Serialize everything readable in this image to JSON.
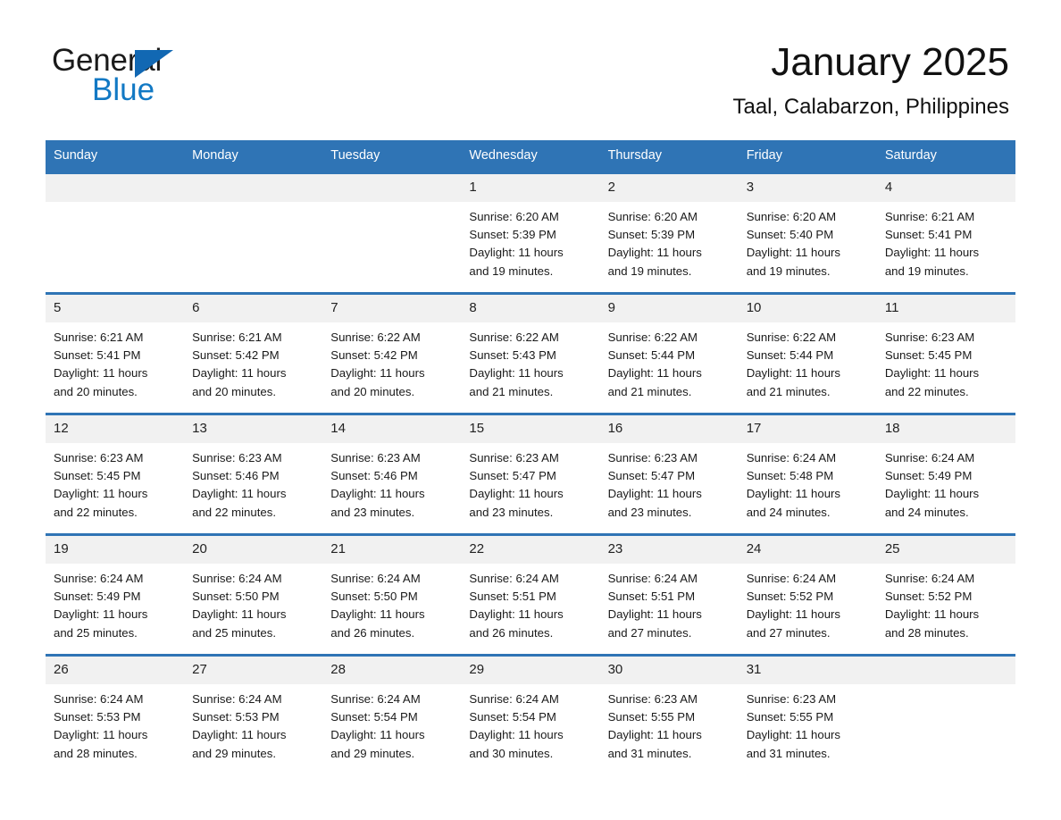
{
  "brand": {
    "name_part1": "General",
    "name_part2": "Blue",
    "accent_color": "#1279c4",
    "triangle_color": "#1268b3"
  },
  "header": {
    "month_title": "January 2025",
    "location": "Taal, Calabarzon, Philippines",
    "header_bg": "#2f74b5"
  },
  "weekdays": [
    "Sunday",
    "Monday",
    "Tuesday",
    "Wednesday",
    "Thursday",
    "Friday",
    "Saturday"
  ],
  "weeks": [
    [
      {
        "date": "",
        "empty": true
      },
      {
        "date": "",
        "empty": true
      },
      {
        "date": "",
        "empty": true
      },
      {
        "date": "1",
        "sunrise": "Sunrise: 6:20 AM",
        "sunset": "Sunset: 5:39 PM",
        "daylight_line1": "Daylight: 11 hours",
        "daylight_line2": "and 19 minutes."
      },
      {
        "date": "2",
        "sunrise": "Sunrise: 6:20 AM",
        "sunset": "Sunset: 5:39 PM",
        "daylight_line1": "Daylight: 11 hours",
        "daylight_line2": "and 19 minutes."
      },
      {
        "date": "3",
        "sunrise": "Sunrise: 6:20 AM",
        "sunset": "Sunset: 5:40 PM",
        "daylight_line1": "Daylight: 11 hours",
        "daylight_line2": "and 19 minutes."
      },
      {
        "date": "4",
        "sunrise": "Sunrise: 6:21 AM",
        "sunset": "Sunset: 5:41 PM",
        "daylight_line1": "Daylight: 11 hours",
        "daylight_line2": "and 19 minutes."
      }
    ],
    [
      {
        "date": "5",
        "sunrise": "Sunrise: 6:21 AM",
        "sunset": "Sunset: 5:41 PM",
        "daylight_line1": "Daylight: 11 hours",
        "daylight_line2": "and 20 minutes."
      },
      {
        "date": "6",
        "sunrise": "Sunrise: 6:21 AM",
        "sunset": "Sunset: 5:42 PM",
        "daylight_line1": "Daylight: 11 hours",
        "daylight_line2": "and 20 minutes."
      },
      {
        "date": "7",
        "sunrise": "Sunrise: 6:22 AM",
        "sunset": "Sunset: 5:42 PM",
        "daylight_line1": "Daylight: 11 hours",
        "daylight_line2": "and 20 minutes."
      },
      {
        "date": "8",
        "sunrise": "Sunrise: 6:22 AM",
        "sunset": "Sunset: 5:43 PM",
        "daylight_line1": "Daylight: 11 hours",
        "daylight_line2": "and 21 minutes."
      },
      {
        "date": "9",
        "sunrise": "Sunrise: 6:22 AM",
        "sunset": "Sunset: 5:44 PM",
        "daylight_line1": "Daylight: 11 hours",
        "daylight_line2": "and 21 minutes."
      },
      {
        "date": "10",
        "sunrise": "Sunrise: 6:22 AM",
        "sunset": "Sunset: 5:44 PM",
        "daylight_line1": "Daylight: 11 hours",
        "daylight_line2": "and 21 minutes."
      },
      {
        "date": "11",
        "sunrise": "Sunrise: 6:23 AM",
        "sunset": "Sunset: 5:45 PM",
        "daylight_line1": "Daylight: 11 hours",
        "daylight_line2": "and 22 minutes."
      }
    ],
    [
      {
        "date": "12",
        "sunrise": "Sunrise: 6:23 AM",
        "sunset": "Sunset: 5:45 PM",
        "daylight_line1": "Daylight: 11 hours",
        "daylight_line2": "and 22 minutes."
      },
      {
        "date": "13",
        "sunrise": "Sunrise: 6:23 AM",
        "sunset": "Sunset: 5:46 PM",
        "daylight_line1": "Daylight: 11 hours",
        "daylight_line2": "and 22 minutes."
      },
      {
        "date": "14",
        "sunrise": "Sunrise: 6:23 AM",
        "sunset": "Sunset: 5:46 PM",
        "daylight_line1": "Daylight: 11 hours",
        "daylight_line2": "and 23 minutes."
      },
      {
        "date": "15",
        "sunrise": "Sunrise: 6:23 AM",
        "sunset": "Sunset: 5:47 PM",
        "daylight_line1": "Daylight: 11 hours",
        "daylight_line2": "and 23 minutes."
      },
      {
        "date": "16",
        "sunrise": "Sunrise: 6:23 AM",
        "sunset": "Sunset: 5:47 PM",
        "daylight_line1": "Daylight: 11 hours",
        "daylight_line2": "and 23 minutes."
      },
      {
        "date": "17",
        "sunrise": "Sunrise: 6:24 AM",
        "sunset": "Sunset: 5:48 PM",
        "daylight_line1": "Daylight: 11 hours",
        "daylight_line2": "and 24 minutes."
      },
      {
        "date": "18",
        "sunrise": "Sunrise: 6:24 AM",
        "sunset": "Sunset: 5:49 PM",
        "daylight_line1": "Daylight: 11 hours",
        "daylight_line2": "and 24 minutes."
      }
    ],
    [
      {
        "date": "19",
        "sunrise": "Sunrise: 6:24 AM",
        "sunset": "Sunset: 5:49 PM",
        "daylight_line1": "Daylight: 11 hours",
        "daylight_line2": "and 25 minutes."
      },
      {
        "date": "20",
        "sunrise": "Sunrise: 6:24 AM",
        "sunset": "Sunset: 5:50 PM",
        "daylight_line1": "Daylight: 11 hours",
        "daylight_line2": "and 25 minutes."
      },
      {
        "date": "21",
        "sunrise": "Sunrise: 6:24 AM",
        "sunset": "Sunset: 5:50 PM",
        "daylight_line1": "Daylight: 11 hours",
        "daylight_line2": "and 26 minutes."
      },
      {
        "date": "22",
        "sunrise": "Sunrise: 6:24 AM",
        "sunset": "Sunset: 5:51 PM",
        "daylight_line1": "Daylight: 11 hours",
        "daylight_line2": "and 26 minutes."
      },
      {
        "date": "23",
        "sunrise": "Sunrise: 6:24 AM",
        "sunset": "Sunset: 5:51 PM",
        "daylight_line1": "Daylight: 11 hours",
        "daylight_line2": "and 27 minutes."
      },
      {
        "date": "24",
        "sunrise": "Sunrise: 6:24 AM",
        "sunset": "Sunset: 5:52 PM",
        "daylight_line1": "Daylight: 11 hours",
        "daylight_line2": "and 27 minutes."
      },
      {
        "date": "25",
        "sunrise": "Sunrise: 6:24 AM",
        "sunset": "Sunset: 5:52 PM",
        "daylight_line1": "Daylight: 11 hours",
        "daylight_line2": "and 28 minutes."
      }
    ],
    [
      {
        "date": "26",
        "sunrise": "Sunrise: 6:24 AM",
        "sunset": "Sunset: 5:53 PM",
        "daylight_line1": "Daylight: 11 hours",
        "daylight_line2": "and 28 minutes."
      },
      {
        "date": "27",
        "sunrise": "Sunrise: 6:24 AM",
        "sunset": "Sunset: 5:53 PM",
        "daylight_line1": "Daylight: 11 hours",
        "daylight_line2": "and 29 minutes."
      },
      {
        "date": "28",
        "sunrise": "Sunrise: 6:24 AM",
        "sunset": "Sunset: 5:54 PM",
        "daylight_line1": "Daylight: 11 hours",
        "daylight_line2": "and 29 minutes."
      },
      {
        "date": "29",
        "sunrise": "Sunrise: 6:24 AM",
        "sunset": "Sunset: 5:54 PM",
        "daylight_line1": "Daylight: 11 hours",
        "daylight_line2": "and 30 minutes."
      },
      {
        "date": "30",
        "sunrise": "Sunrise: 6:23 AM",
        "sunset": "Sunset: 5:55 PM",
        "daylight_line1": "Daylight: 11 hours",
        "daylight_line2": "and 31 minutes."
      },
      {
        "date": "31",
        "sunrise": "Sunrise: 6:23 AM",
        "sunset": "Sunset: 5:55 PM",
        "daylight_line1": "Daylight: 11 hours",
        "daylight_line2": "and 31 minutes."
      },
      {
        "date": "",
        "empty": true
      }
    ]
  ]
}
